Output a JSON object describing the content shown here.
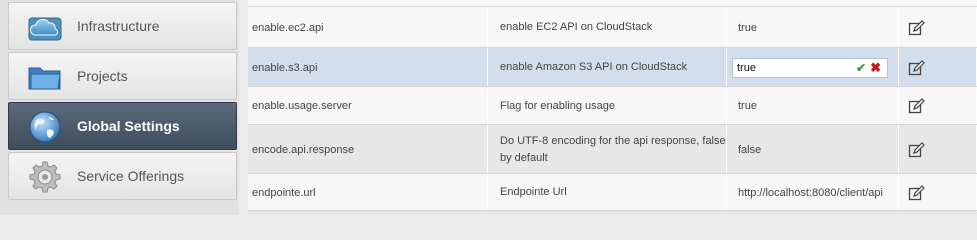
{
  "sidebar": {
    "items": [
      {
        "label": "Infrastructure",
        "icon": "cloud-icon",
        "active": false
      },
      {
        "label": "Projects",
        "icon": "folder-icon",
        "active": false
      },
      {
        "label": "Global Settings",
        "icon": "globe-icon",
        "active": true
      },
      {
        "label": "Service Offerings",
        "icon": "gear-icon",
        "active": false
      }
    ]
  },
  "rows": [
    {
      "name": "enable.ec2.api",
      "description": "enable EC2 API on CloudStack",
      "value": "true"
    },
    {
      "name": "enable.s3.api",
      "description": "enable Amazon S3 API on CloudStack",
      "value": "true",
      "editing": true
    },
    {
      "name": "enable.usage.server",
      "description": "Flag for enabling usage",
      "value": "true"
    },
    {
      "name": "encode.api.response",
      "description": "Do UTF-8 encoding for the api response, false by default",
      "value": "false"
    },
    {
      "name": "endpointe.url",
      "description": "Endpointe Url",
      "value": "http://localhost:8080/client/api"
    }
  ],
  "icons": {
    "confirm": "✔",
    "cancel": "✖",
    "edit": "edit-icon"
  },
  "colors": {
    "active_nav": "#4a5968",
    "selected_row": "#d3deec",
    "confirm": "#35a235",
    "cancel": "#c21818"
  }
}
